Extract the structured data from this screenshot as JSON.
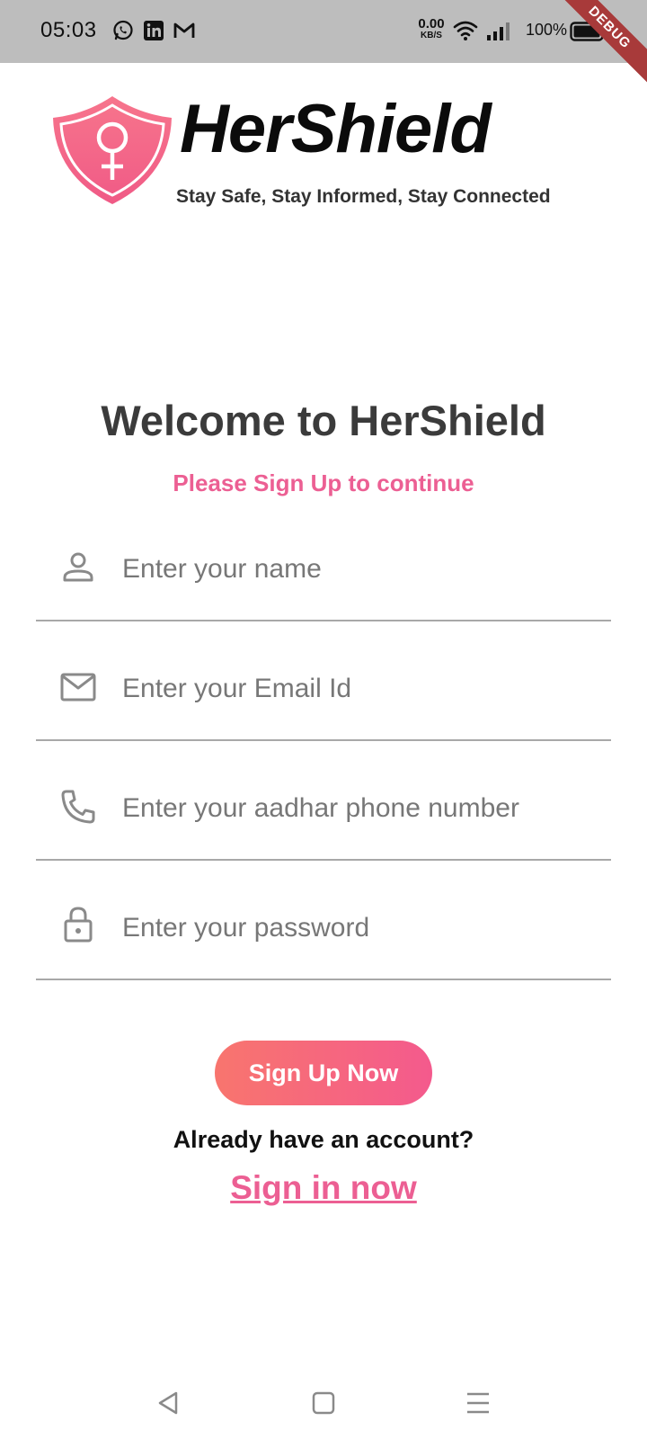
{
  "status_bar": {
    "time": "05:03",
    "network_speed_value": "0.00",
    "network_speed_unit": "KB/S",
    "battery": "100%",
    "debug_banner": "DEBUG",
    "notification_icons": [
      "whatsapp-icon",
      "linkedin-icon",
      "gmail-icon"
    ]
  },
  "logo": {
    "title": "HerShield",
    "tagline": "Stay Safe, Stay Informed, Stay Connected"
  },
  "welcome": {
    "title": "Welcome to HerShield",
    "subtitle": "Please Sign Up to continue"
  },
  "form": {
    "name_placeholder": "Enter your name",
    "email_placeholder": "Enter your Email Id",
    "phone_placeholder": "Enter your aadhar phone number",
    "password_placeholder": "Enter your password",
    "name_value": "",
    "email_value": "",
    "phone_value": "",
    "password_value": ""
  },
  "actions": {
    "signup_label": "Sign Up Now",
    "already_text": "Already have an account?",
    "signin_label": "Sign in now"
  },
  "colors": {
    "accent": "#ec5f93",
    "button_gradient_start": "#f8756e",
    "button_gradient_end": "#f45a8d",
    "status_bar_bg": "#bdbdbd"
  },
  "nav_bar": {
    "icons": [
      "back-icon",
      "home-icon",
      "recents-icon"
    ]
  }
}
